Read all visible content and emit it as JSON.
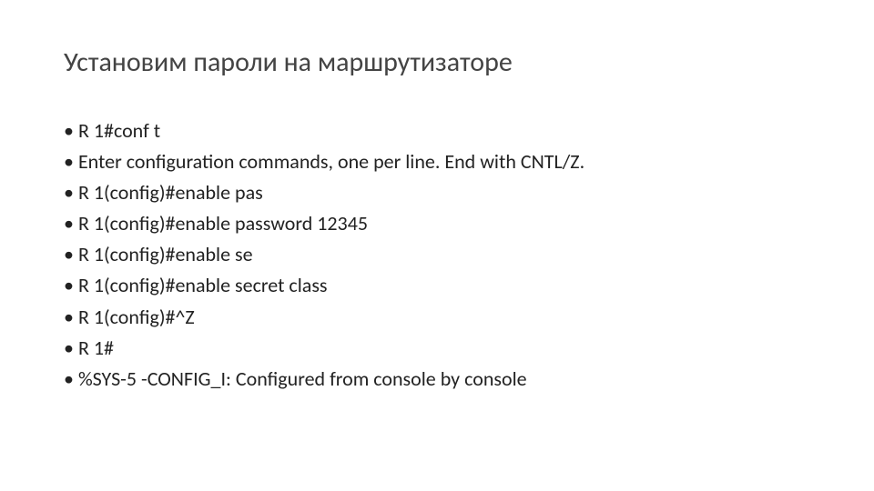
{
  "title": "Установим пароли на маршрутизаторе",
  "lines": [
    "R 1#conf t",
    "Enter configuration commands, one per line. End with CNTL/Z.",
    "R 1(config)#enable pas",
    "R 1(config)#enable password 12345",
    "R 1(config)#enable se",
    "R 1(config)#enable secret class",
    "R 1(config)#^Z",
    "R 1#",
    "%SYS-5 -CONFIG_I: Configured from console by console"
  ]
}
